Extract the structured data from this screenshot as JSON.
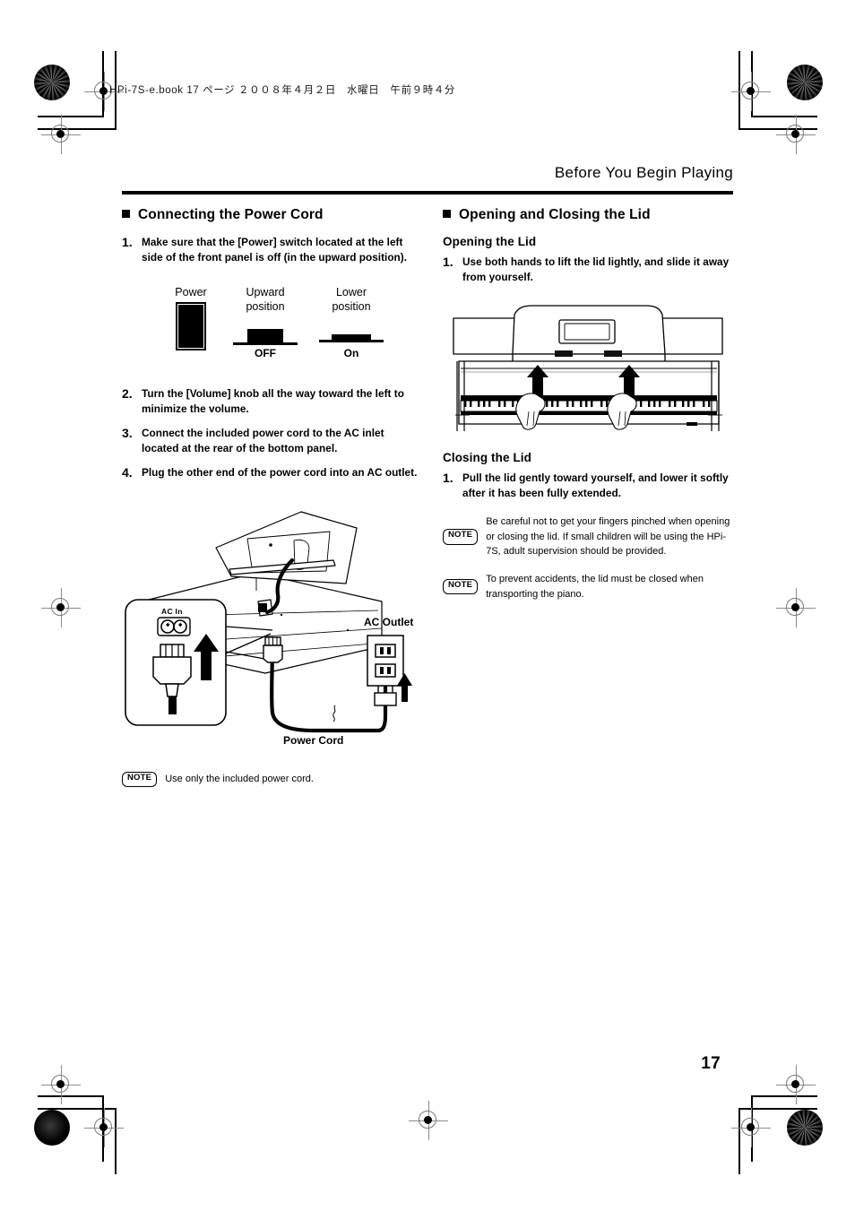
{
  "print_meta": {
    "file_line": "HPi-7S-e.book  17 ページ  ２００８年４月２日　水曜日　午前９時４分"
  },
  "running_head": "Before You Begin Playing",
  "page_number": "17",
  "left_column": {
    "section_title": "Connecting the Power Cord",
    "steps": [
      {
        "num": "1.",
        "text": "Make sure that the [Power] switch located at the left side of the front panel is off (in the upward position)."
      },
      {
        "num": "2.",
        "text": "Turn the [Volume] knob all the way toward the left to minimize the volume."
      },
      {
        "num": "3.",
        "text": "Connect the included power cord to the AC inlet located at the rear of the bottom panel."
      },
      {
        "num": "4.",
        "text": "Plug the other end of the power cord into an AC outlet."
      }
    ],
    "power_figure": {
      "power_label": "Power",
      "upward_label": "Upward\nposition",
      "lower_label": "Lower\nposition",
      "off_label": "OFF",
      "on_label": "On"
    },
    "cord_figure": {
      "ac_in_label": "AC In",
      "ac_outlet_label": "AC Outlet",
      "power_cord_label": "Power Cord"
    },
    "note": {
      "badge": "NOTE",
      "text": "Use only the included power cord."
    }
  },
  "right_column": {
    "section_title": "Opening and Closing the Lid",
    "opening": {
      "heading": "Opening the Lid",
      "step_num": "1.",
      "step_text": "Use both hands to lift the lid lightly, and slide it away from yourself."
    },
    "closing": {
      "heading": "Closing the Lid",
      "step_num": "1.",
      "step_text": "Pull the lid gently toward yourself, and lower it softly after it has been fully extended."
    },
    "notes": [
      {
        "badge": "NOTE",
        "text": "Be careful not to get your fingers pinched when opening or closing the lid. If small children will be using the HPi-7S, adult supervision should be provided."
      },
      {
        "badge": "NOTE",
        "text": "To prevent accidents, the lid must be closed when transporting the piano."
      }
    ]
  }
}
